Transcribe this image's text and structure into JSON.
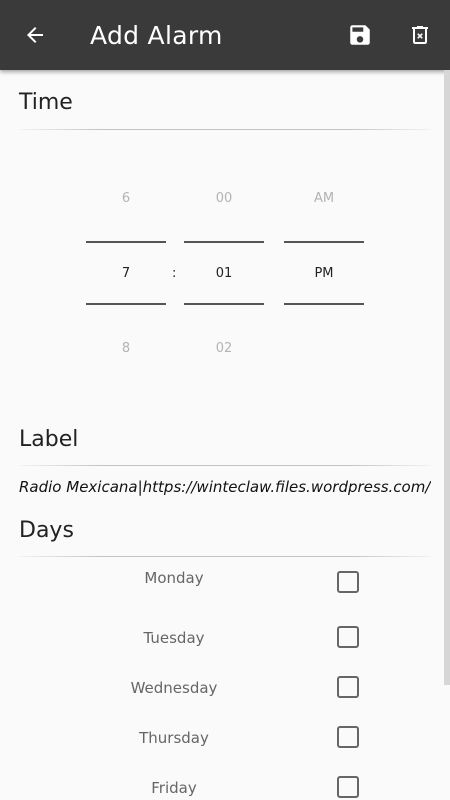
{
  "toolbar": {
    "title": "Add Alarm",
    "back_icon": "arrow-back-icon",
    "save_icon": "save-icon",
    "delete_icon": "delete-icon"
  },
  "time_section": {
    "title": "Time",
    "hour": {
      "prev": "6",
      "selected": "7",
      "next": "8"
    },
    "separator": ":",
    "minute": {
      "prev": "00",
      "selected": "01",
      "next": "02"
    },
    "ampm": {
      "prev": "AM",
      "selected": "PM"
    }
  },
  "label_section": {
    "title": "Label",
    "value": "Radio Mexicana|https://winteclaw.files.wordpress.com/"
  },
  "days_section": {
    "title": "Days",
    "days": [
      {
        "label": "Monday",
        "checked": false
      },
      {
        "label": "Tuesday",
        "checked": false
      },
      {
        "label": "Wednesday",
        "checked": false
      },
      {
        "label": "Thursday",
        "checked": false
      },
      {
        "label": "Friday",
        "checked": false
      }
    ]
  },
  "colors": {
    "toolbar_bg": "#3a3a3a",
    "background": "#fafafa",
    "text_primary": "#222222",
    "text_faded": "#b3b3b3"
  }
}
